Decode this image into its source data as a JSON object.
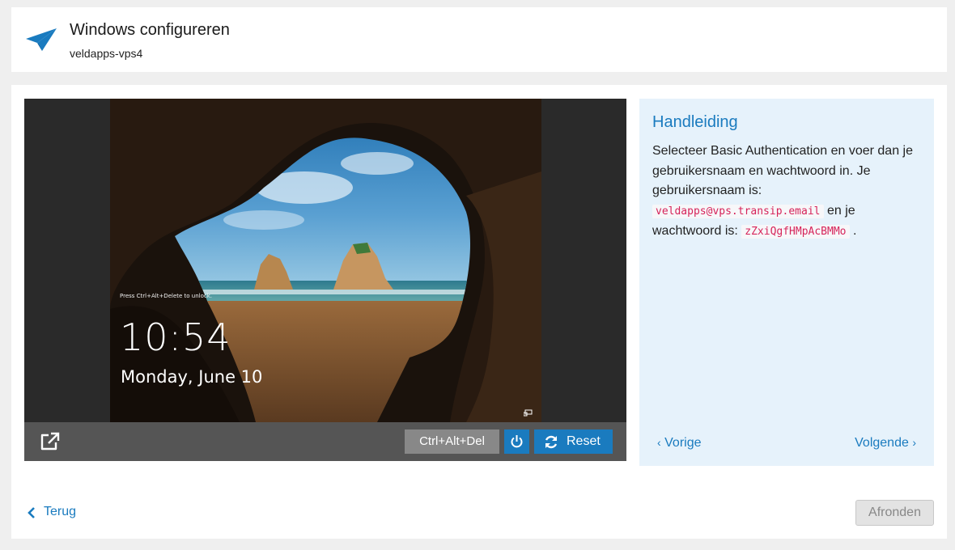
{
  "header": {
    "title": "Windows configureren",
    "subtitle": "veldapps-vps4",
    "logo_icon": "paper-plane-icon",
    "accent_color": "#1a7bbf"
  },
  "console": {
    "lock_screen": {
      "unlock_hint": "Press Ctrl+Alt+Delete to unlock.",
      "time": "10:54",
      "date": "Monday, June 10",
      "network_icon": "network-icon"
    },
    "toolbar": {
      "external_icon": "external-link-icon",
      "ctrl_alt_del_label": "Ctrl+Alt+Del",
      "power_icon": "power-icon",
      "reset_label": "Reset",
      "reset_icon": "refresh-icon"
    }
  },
  "guide": {
    "title": "Handleiding",
    "text_1": "Selecteer Basic Authentication en voer dan je gebruikersnaam en wachtwoord in. Je gebruikersnaam is: ",
    "username": "veldapps@vps.transip.email",
    "text_2": " en je wachtwoord is: ",
    "password": "zZxiQgfHMpAcBMMo",
    "text_3": " .",
    "prev_label": "Vorige",
    "next_label": "Volgende"
  },
  "footer": {
    "back_label": "Terug",
    "finish_label": "Afronden"
  }
}
